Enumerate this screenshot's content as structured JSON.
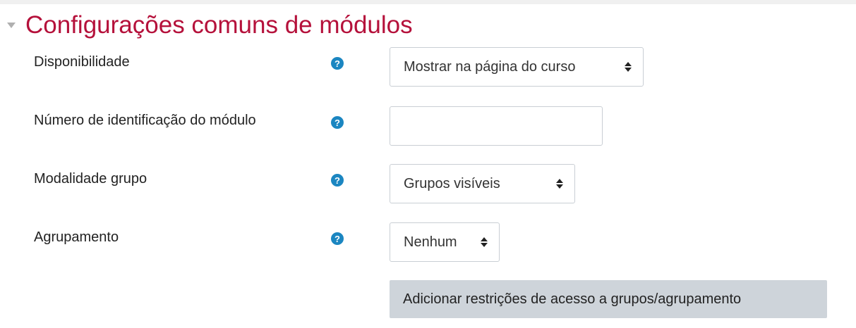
{
  "section": {
    "title": "Configurações comuns de módulos"
  },
  "fields": {
    "availability": {
      "label": "Disponibilidade",
      "value": "Mostrar na página do curso"
    },
    "idnumber": {
      "label": "Número de identificação do módulo",
      "value": ""
    },
    "groupmode": {
      "label": "Modalidade grupo",
      "value": "Grupos visíveis"
    },
    "grouping": {
      "label": "Agrupamento",
      "value": "Nenhum"
    }
  },
  "help_glyph": "?",
  "restrict_button": {
    "label": "Adicionar restrições de acesso a grupos/agrupamento"
  },
  "colors": {
    "title": "#b5113b",
    "help_icon": "#1b86c1",
    "button_bg": "#ced4da"
  }
}
